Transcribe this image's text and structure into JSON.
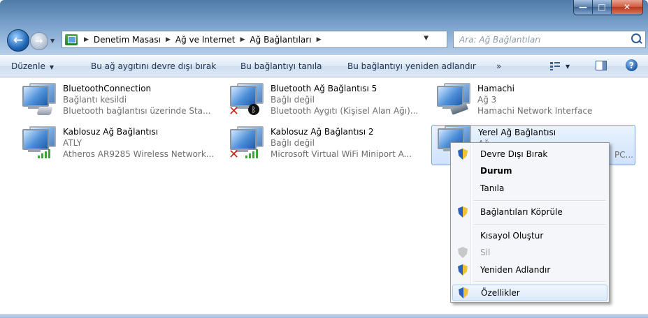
{
  "window": {
    "controls": {
      "minimize": "—",
      "maximize": "□",
      "close": "✕"
    }
  },
  "nav": {
    "breadcrumbs": [
      "Denetim Masası",
      "Ağ ve Internet",
      "Ağ Bağlantıları"
    ],
    "search_placeholder": "Ara: Ağ Bağlantıları"
  },
  "toolbar": {
    "organize": "Düzenle",
    "disable_device": "Bu ağ aygıtını devre dışı bırak",
    "diagnose": "Bu bağlantıyı tanıla",
    "rename": "Bu bağlantıyı yeniden adlandır",
    "more": "»"
  },
  "connections": [
    {
      "name": "BluetoothConnection",
      "status": "Bağlantı kesildi",
      "device": "Bluetooth bağlantısı üzerinde Sta...",
      "badge": "phone-icon"
    },
    {
      "name": "Bluetooth Ağ Bağlantısı 5",
      "status": "Bağlı değil",
      "device": "Bluetooth Aygıtı (Kişisel Alan Ağı)...",
      "badge": "bluetooth-icon"
    },
    {
      "name": "Hamachi",
      "status": "Ağ 3",
      "device": "Hamachi Network Interface",
      "badge": "cable-icon"
    },
    {
      "name": "Kablosuz Ağ Bağlantısı",
      "status": "ATLY",
      "device": "Atheros AR9285 Wireless Network...",
      "badge": "signal-icon"
    },
    {
      "name": "Kablosuz Ağ Bağlantısı 2",
      "status": "Bağlı değil",
      "device": "Microsoft Virtual WiFi Miniport A...",
      "badge": "signal-icon"
    },
    {
      "name": "Yerel Ağ Bağlantısı",
      "status": "Ağ",
      "device": "PC...",
      "badge": "cable-icon"
    }
  ],
  "context_menu": {
    "items": [
      {
        "label": "Devre Dışı Bırak",
        "icon": "shield-icon"
      },
      {
        "label": "Durum",
        "bold": true
      },
      {
        "label": "Tanıla"
      },
      {
        "label": "Bağlantıları Köprüle",
        "icon": "shield-icon"
      },
      {
        "label": "Kısayol Oluştur"
      },
      {
        "label": "Sil",
        "icon": "shield-icon",
        "disabled": true
      },
      {
        "label": "Yeniden Adlandır",
        "icon": "shield-icon"
      },
      {
        "label": "Özellikler",
        "icon": "shield-icon",
        "hover": true
      }
    ]
  },
  "colors": {
    "selection_border": "#7da2ce",
    "disconnected_x": "#d02020",
    "signal_green": "#3fa43a"
  }
}
